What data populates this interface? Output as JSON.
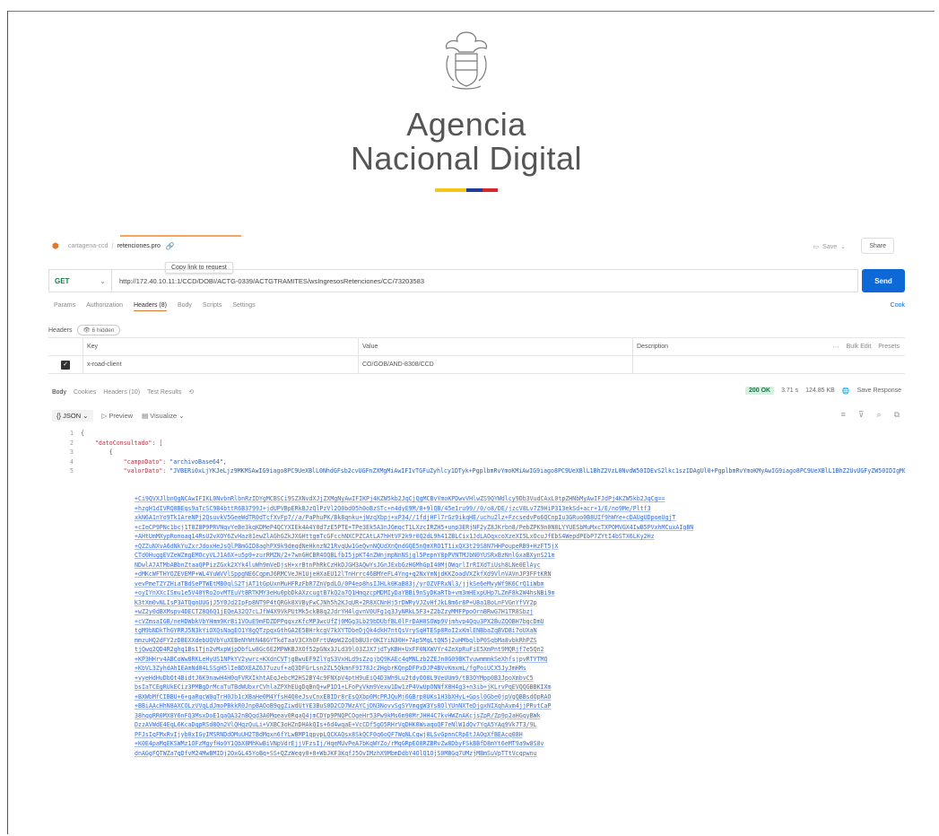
{
  "logo": {
    "line1": "Agencia",
    "line2": "Nacional Digital",
    "flag_colors": [
      "#f5c518",
      "#1f3e96",
      "#d42a2a"
    ]
  },
  "postman": {
    "breadcrumb": {
      "workspace": "cartagena-ccd",
      "request": "retenciones.pro"
    },
    "save_label": "Save",
    "share_label": "Share",
    "tooltip": "Copy link to request",
    "method": "GET",
    "url": "http://172.40.10.11:1/CCD/DOBI/ACTG-0339/ACTGTRAMITES/wsIngresosRetenciones/CC/73203583",
    "send_label": "Send",
    "cookies_label": "Cook",
    "req_tabs": [
      "Params",
      "Authorization",
      "Headers (8)",
      "Body",
      "Scripts",
      "Settings"
    ],
    "headers_label": "Headers",
    "hidden_label": "6 hidden",
    "table": {
      "col_key": "Key",
      "col_value": "Value",
      "col_desc": "Description",
      "bulk_edit": "Bulk Edit",
      "presets": "Presets",
      "rows": [
        {
          "key": "x-road-client",
          "value": "CO/GOB/AND-8308/CCD"
        }
      ]
    },
    "resp_tabs": [
      "Body",
      "Cookies",
      "Headers (10)",
      "Test Results"
    ],
    "status": {
      "code": "200 OK",
      "time": "3.71 s",
      "size": "124.85 KB",
      "save_label": "Save Response"
    },
    "resp_toolbar": {
      "format": "JSON",
      "preview": "Preview",
      "visualize": "Visualize"
    },
    "code": {
      "line_numbers": [
        "1",
        "2",
        "3",
        "4",
        "5"
      ],
      "key_datos": "\"datoConsultado\": [",
      "key_campo": "\"campoDato\": ",
      "val_campo": "\"archivoBase64\",",
      "key_valor": "\"valorDato\": ",
      "val_valor_start": "\"JVBERi0xLjYKJeLjz9MKMSAwIG9iago8PC9UeXBlL0NhdGFsb2cvUGFnZXMgMiAwIFIvTGFuZyhlcy1DTyk+PgplbmRvYmoKMiAwIG9iago8PC9UeXBlL1BhZ2VzL0NvdW50IDEvS2lkc1szIDAgUl0+PgplbmRvYmoKMyAwIG9iago8PC9UeXBlL1BhZ2UvUGFyZW50IDIgMCBSL01lZGlhQm94WzAgMCA2MTIgNzkyXQ==",
      "b64_lines": [
        "+Ci9QVXJlbnQgNCAwIFIKL0NvbnRlbnRzIDYgMCBSCi9SZXNvdXJjZXMgNyAwIFIKPj4KZW5kb2JqCjQgMCBvYmoKPDwvVHlwZS9QYWdlcy9Db3VudCAxL0tpZHNbMyAwIFJdPj4KZW5kb2JqCg==",
        "+hzgH1dIVRQ8BEgs9aTcSC9B4bttR6B3799J+jdUPVBpERkBJzQlPzVl2Q0bd05h0oBzSTc+n4dyE9M/8+9lQB/45e1ru99//0/o8/DE/jzcV8Lv7Z9HiP313ekSd+acr+1/E/no9Me/Pltf3",
        "xkN6A1nYo9Tk1AreNPj2QsuvkV5GeeWdTR0dTcfXvFp7//a/PaPhuPK/Bk8qnku+jWzqXbpj+xP34//1fdjHFl7rGz9ikqHE/uchu2lz+FzcsedvPo6QCnpIu3GRuo0B8UIf9hWYe+cDAUgUDpoeUgjT",
        "+cIeCP9PNc1bcj1T8Z8P9PRVNqvYeBe3kqKDMeP4QCYXIEk4A4Y0d7zE5PTE+TPe3Ek5A3nJGmqcT1LXzcIRZH5+unp3ERjNF2yZ8JKrbn8/PebZPK9n0N8LYYUESbMuMxcTXPOMVGX4IwB5PVxhMCuxAIgBN",
        "+AHtUmMXypRonoaq14RsU2vXOY6ZvHaz81ewZlAGhGZkJXGHttgmTcGFcchNXCPZCAtLA7hHtVF2k9r0Q2dL9h41ZBLCix1JdLAOqxcoXzeXI5LxOcuJfEbS4WepdPEbP7ZYtI4bSTX6LKy2Hz",
        "+QZZuNXvA6dNkYuZxrJdoxHeJsQlPBmGID8aghPX9k9dmqdNeHknzN21RvqUw1GeQvnNQUdXnQndGQE5nQmXRO1T1ixQX3t29S8N7HHPoupeRB9+HzFT5jX",
        "CTd0HuggEVZeWZmgEMOcyVLJ1A6X+u5p9+zurRMZN/2+7wnGHCBR4OQBLfbI5jpKT4nZWnjmpNnNSjgl5PepnY8pPVNTMJbN0YUSRxBzNnlGxaBXynS21m",
        "NDwlA7ATMbABbnZtaaQPPizZGxk2XYk4luWh9mVeDjsH+xrBtnPhRkCzHkDJGH3AQwYsJGnJExbGzHGMhGpI40MjOWqrlIrRIXdTiUsh8LNe0ElAyc",
        "+dMKcWFTHYOZEVEMP+WL4YuWVVlSppgNE6CqpmJ6RMCVeJH1UjeHXaEU12lTnHrrc46BMYeFL4Yng+q2NxYmNjdKKZoadVXZkfXd9VlnVAVnJP3FFtKRN",
        "vevPmeTZYZHiaTBdSePTWEtMB0qlS2TjAT1tGpUxnMuHFRzFbR7ZnVpdLO/0P4ep8hsIJHLk0KaB83j/yrOZVFRxNl3/jjkSe6eMvyWf9K6CrQ1iWbm",
        "+oyIYnXXcISmu1e5V40YRo2ovMTEuVtBRTKMY3eHu0pbDkAXzcugtB7kQ2a7Q1HmqzcpMDMIyDaYBBi9nSyDKaRTb+vm3mHExpUHp7LZmF8k2W4hsNBi9m",
        "K3tXm0vNLIsP3ATQqnUUGjJ5Y0Jd2IpFp8NT9P4tQRGk8XVByFwCJNh5h2KJqUR+2R8XCNnHj5rDWRyVJZvHfJkL8m6r8P+U8a1BoLnFVGnYfVY2p",
        "+wZ2y0dBXMspv4DECTZ8Q6Q1jEQeA32Q7cLJfW4X9VkPUtMk5ckB8q2JdrYH4lgvnV0UFg1q3JyNRkL5F3+Z2bZzyMMFPpoOrnBRwG7H1TR8Sbzj",
        "+cVZmsaIGB/neHDWbkVbYHmm9KrBi1VOuE9mFDZDPPqgxzKfcMP3wcUfZj0MGg3Lb29bDUbfBL0lFrDAH0SOWp9Vjmhvp4Qqu3PX2BuZQOBH7bgcDmU",
        "tgM9bNDkThGYRRJ5N3kYiOXQsNagEO1Y8gQTzpqxGthGA2E5BHrkcgV7kXYTDbeDjQk4dkH7ntQsVrySqHTESp8RoI2xKmlENBbaZqBVDBi7oUXaN",
        "mmzuHQ2dFY2zDBEXXdebUQVbYuXEBeNYWtN48GYTkdTaaV3CXhOFrtUWpW2ZoEbBU3r0KIYiN30H+7Ap5MgLtQN5j2uHMbqlbP0SqbMa8vbkRhPZS",
        "tjQwq2QD4R2ghq1Bs1Tjn2vMxpWjpDbfLw8Gc6E2MPWKBJXOf52pGNx3JLd39l03ZJX7jdTyKBH+UxFF0NXWVYr4ZeXpRuFiE5XmPnt9MQRjf7e5Qn2",
        "+KP3HHrv4ABCoWw8RKLeHyUS1NPkYV2ywrc+KXdnCVTjgBwuEF9ZlYgS3VxHLd9sZzgjbQ9KAEc4qMNLzb2ZEJn0G09BKTvuwmmmkSeXhfsjpvRTYTMQ",
        "+KbVL3ZyhdAhIEAmNd84LSSgH5lIeBDXEAZ6J7uzuf+aQ3DFGrLsn2ZL5QkmnF9I78Jc2HgbrKQnpDFPxDJP4BVvKmxmL/fgPoiUCX5JyJmHMs",
        "+vyeHdHuDbOt4BidtJ6K9nawH4H0qFVRXIkhtAEqJebcM2HS2BY4c9FNXpV4ptH9uEiQ4D3Wh9Lu2tdyOO8L9VeUUm9/tB3OYMpp0B3JpoXmbvC5",
        "bsIaTCEgRUkECiz3PMBgDrMcaTuTBdWUbxrCVhlaZPXhEUgDqBnQ+wP1D1+LFoPyVkm9Vexw1Dw1zP4VwUpONNfX8H4g3+n3ib+jKLrvPqEVQQGBBKIXm",
        "+BXWbMfCIBBU+6+gaRgcW0gTrH0Jb1cXBaHe0M4YfsH4Q0eJsvCnxEBIDr8rEsQXbp0McPRJQuMj6GBrp0UKs1H3bXHyL+Gpsl0Gbe0jpVgQBBsdOpRAO",
        "+BBiAAcHhN8AXCOLzVVqLdJmoPBkkR0JnpBAOoB9qgZiwdUtYE3BuS0D2CD7WzAYCjDN3NovvSgSYVmqgW3Ys8OlYUnNXTeDjgxNIXqhAvm4jjPRvtCaP",
        "38hqgRR0MX8Y6nFQ3MsxDoE1qaQA32nBQqd3A0Mqeav0RqaQ4jmCDYp9PNQPCOgeHr53Pw9kMs6m90MrJHH4C7kvHWZnAKcjsZpR/Zp9p2aHGqyBWk",
        "DzzAVWdE4EqL6KcaDqpRSd8Qn2VlQHqzQuLi+VXBC3oHZnDHAkQIs+6d4wqaE+VcCDf5gO5RHrVqDHK0WsaqoQF7eNlW1dQv7YqA5YAq9Vk7T3/9L",
        "PFJsIqFMxRvIjyb0xIGyIMSRNDdOMuUH2TBdMqxn6fYLwBMP1qpvpLQCKAQsx8SkQCF0q6oQF7WqNLCgwj8LSvGpnnCRpEtJAOgXfBEAcq08H",
        "+K0E4paMqEKSWMz1OFzMgyfHo9Y1QbX8MhKwBiVNpVdrEjjVFzsIj/HqeMUvPeA7bKqWYZo/rMqGRpEO8RZBRvZw8DbyFSkBBfD8mYt6eMT9a9w8S8v",
        "dnAGgFQTWZa7qDfvM24MwBMIDj2OxGL45YoBq+SS+QZzWeqy0+8+WbJKF3KqfJ5OvIMzhX9MbmDdbY4OlQ1OjS0MBGq7UMzjMBmSuVpTTtVcqpwnu"
      ]
    }
  }
}
